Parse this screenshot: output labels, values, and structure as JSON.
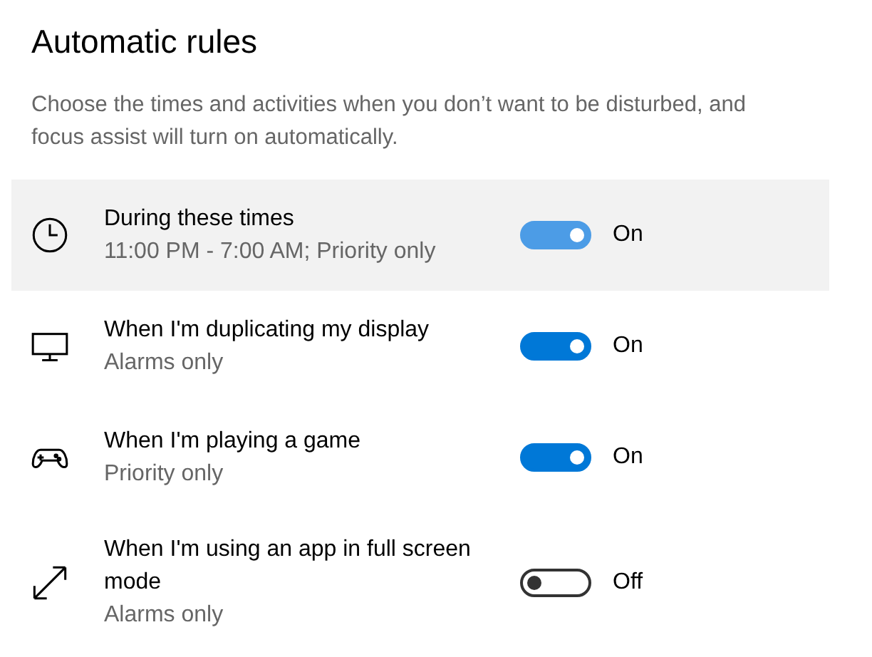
{
  "heading": "Automatic rules",
  "description": "Choose the times and activities when you don’t want to be disturbed, and focus assist will turn on automatically.",
  "rules": [
    {
      "kind": "clock",
      "title": "During these times",
      "subtitle": "11:00 PM - 7:00 AM; Priority only",
      "on": true,
      "state_label": "On",
      "hovered": true
    },
    {
      "kind": "monitor",
      "title": "When I'm duplicating my display",
      "subtitle": "Alarms only",
      "on": true,
      "state_label": "On",
      "hovered": false
    },
    {
      "kind": "gamepad",
      "title": "When I'm playing a game",
      "subtitle": "Priority only",
      "on": true,
      "state_label": "On",
      "hovered": false
    },
    {
      "kind": "expand",
      "title": "When I'm using an app in full screen mode",
      "subtitle": "Alarms only",
      "on": false,
      "state_label": "Off",
      "hovered": false
    }
  ]
}
